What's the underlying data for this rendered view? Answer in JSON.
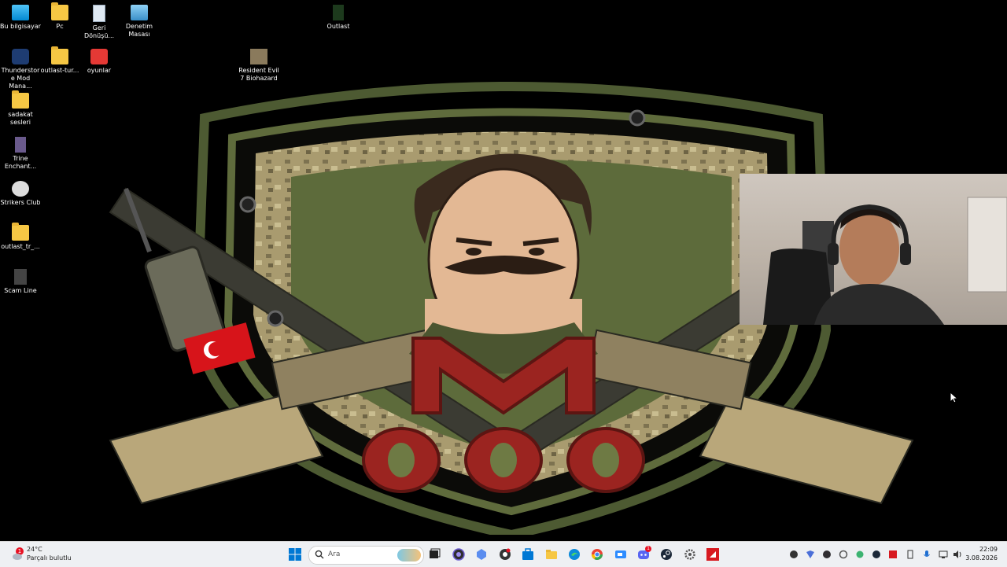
{
  "desktop": {
    "icons": [
      {
        "id": "bu-bilgisayar",
        "label": "Bu bilgisayar"
      },
      {
        "id": "pc",
        "label": "Pc"
      },
      {
        "id": "geri-donusum",
        "label": "Geri Dönüşü..."
      },
      {
        "id": "denetim-masasi",
        "label": "Denetim Masası"
      },
      {
        "id": "outlast",
        "label": "Outlast"
      },
      {
        "id": "thunderstore",
        "label": "Thunderstore Mod Mana..."
      },
      {
        "id": "outlast-tur",
        "label": "outlast-tur..."
      },
      {
        "id": "oyunlar",
        "label": "oyunlar"
      },
      {
        "id": "resident-evil",
        "label": "Resident Evil 7 Biohazard"
      },
      {
        "id": "sadakat",
        "label": "sadakat sesleri"
      },
      {
        "id": "trine",
        "label": "Trine Enchant..."
      },
      {
        "id": "strikers",
        "label": "Strikers Club"
      },
      {
        "id": "outlast-tr",
        "label": "outlast_tr_..."
      },
      {
        "id": "scam-line",
        "label": "Scam Line"
      }
    ],
    "wallpaper": {
      "letter": "M",
      "number": "000"
    }
  },
  "taskbar": {
    "weather": {
      "temp": "24°C",
      "condition": "Parçalı bulutlu",
      "badge": "1"
    },
    "search": {
      "placeholder": "Ara"
    },
    "apps": [
      "start-icon",
      "search-icon",
      "widgets-icon",
      "task-view-icon",
      "obs-icon",
      "app-icon",
      "chrome-alt-icon",
      "store-icon",
      "file-explorer-icon",
      "edge-icon",
      "chrome-icon",
      "zoom-icon",
      "discord-icon",
      "steam-icon",
      "settings-icon",
      "amd-icon"
    ],
    "discord_badge": "1",
    "clock": {
      "time": "22:09",
      "date": "3.08.2026"
    },
    "colors": {
      "bar": "#eef0f3",
      "accent": "#0067c0"
    }
  }
}
